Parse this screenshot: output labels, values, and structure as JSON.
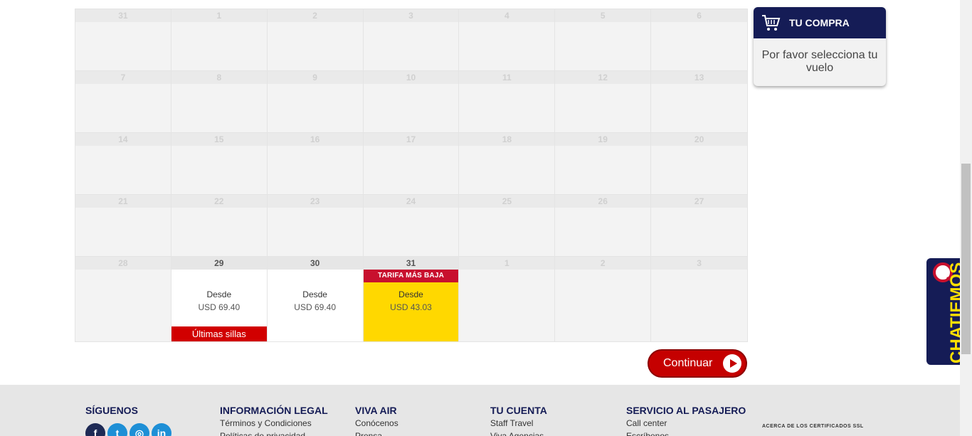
{
  "calendar": {
    "weeks": [
      [
        {
          "day": "31"
        },
        {
          "day": "1"
        },
        {
          "day": "2"
        },
        {
          "day": "3"
        },
        {
          "day": "4"
        },
        {
          "day": "5"
        },
        {
          "day": "6"
        }
      ],
      [
        {
          "day": "7"
        },
        {
          "day": "8"
        },
        {
          "day": "9"
        },
        {
          "day": "10"
        },
        {
          "day": "11"
        },
        {
          "day": "12"
        },
        {
          "day": "13"
        }
      ],
      [
        {
          "day": "14"
        },
        {
          "day": "15"
        },
        {
          "day": "16"
        },
        {
          "day": "17"
        },
        {
          "day": "18"
        },
        {
          "day": "19"
        },
        {
          "day": "20"
        }
      ],
      [
        {
          "day": "21"
        },
        {
          "day": "22"
        },
        {
          "day": "23"
        },
        {
          "day": "24"
        },
        {
          "day": "25"
        },
        {
          "day": "26"
        },
        {
          "day": "27"
        }
      ],
      [
        {
          "day": "28"
        },
        {
          "day": "29",
          "fare_label": "Desde",
          "price": "USD 69.40",
          "bottom_badge": "Últimas sillas"
        },
        {
          "day": "30",
          "fare_label": "Desde",
          "price": "USD 69.40"
        },
        {
          "day": "31",
          "top_badge": "TARIFA MÁS BAJA",
          "fare_label": "Desde",
          "price": "USD 43.03",
          "cheapest": true
        },
        {
          "day": "1"
        },
        {
          "day": "2"
        },
        {
          "day": "3"
        }
      ]
    ]
  },
  "purchase": {
    "title": "TU COMPRA",
    "message": "Por favor selecciona tu vuelo"
  },
  "continue_label": "Continuar",
  "chat_label": "CHATIEMOS",
  "colors": {
    "navy": "#151c56",
    "red": "#c50000",
    "yellow": "#ffd800",
    "chat_text": "#ffe000"
  },
  "footer": {
    "social": {
      "title": "SÍGUENOS",
      "icons": [
        "facebook-icon",
        "twitter-icon",
        "instagram-icon",
        "linkedin-icon"
      ]
    },
    "legal": {
      "title": "INFORMACIÓN LEGAL",
      "links": [
        "Términos y Condiciones",
        "Políticas de privacidad"
      ]
    },
    "vivaair": {
      "title": "VIVA AIR",
      "links": [
        "Conócenos",
        "Prensa"
      ]
    },
    "account": {
      "title": "TU CUENTA",
      "links": [
        "Staff Travel",
        "Viva Agencias"
      ]
    },
    "service": {
      "title": "SERVICIO AL PASAJERO",
      "links": [
        "Call center",
        "Escríbenos"
      ]
    },
    "ssl_text": "ACERCA DE LOS CERTIFICADOS SSL"
  }
}
